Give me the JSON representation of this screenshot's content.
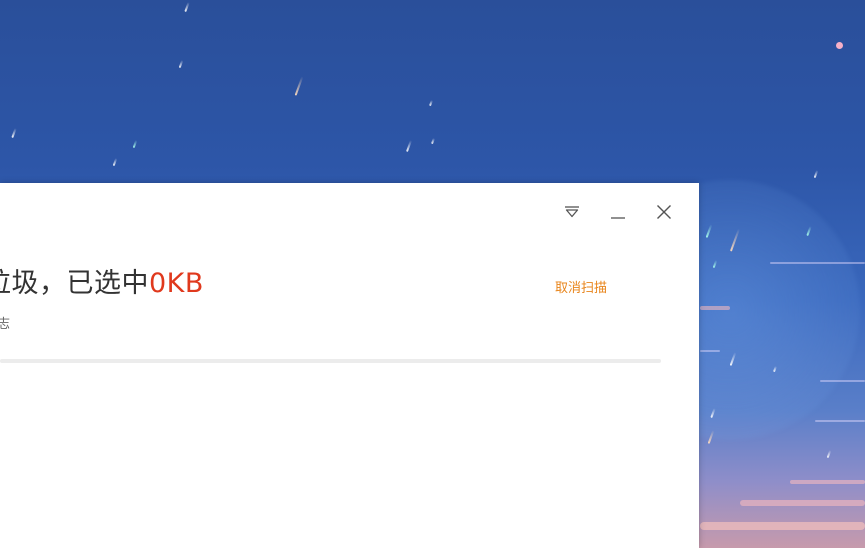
{
  "window": {
    "controls": {
      "menu_icon": "dropdown-triangle-icon",
      "minimize_icon": "minimize-icon",
      "close_icon": "close-icon"
    },
    "status": {
      "title_prefix": "垃圾，已选中",
      "selected_size": "0KB",
      "subtitle": "志"
    },
    "cancel_scan_label": "取消扫描",
    "progress_fraction": 0
  },
  "colors": {
    "accent_orange": "#e8841a",
    "size_red": "#e0391d",
    "text_dark": "#333333",
    "desktop_blue": "#2d56a8"
  }
}
